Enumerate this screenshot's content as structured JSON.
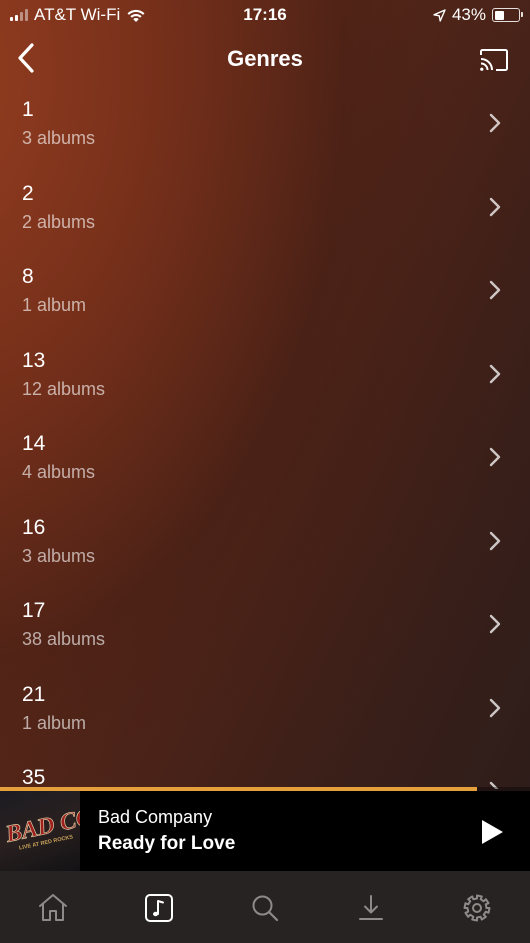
{
  "status_bar": {
    "carrier": "AT&T Wi-Fi",
    "time": "17:16",
    "battery_percent_label": "43%",
    "battery_level": 0.43
  },
  "header": {
    "title": "Genres",
    "back_icon": "chevron-left-icon",
    "cast_icon": "cast-icon"
  },
  "genres": [
    {
      "name": "1",
      "count": "3 albums"
    },
    {
      "name": "2",
      "count": "2 albums"
    },
    {
      "name": "8",
      "count": "1 album"
    },
    {
      "name": "13",
      "count": "12 albums"
    },
    {
      "name": "14",
      "count": "4 albums"
    },
    {
      "name": "16",
      "count": "3 albums"
    },
    {
      "name": "17",
      "count": "38 albums"
    },
    {
      "name": "21",
      "count": "1 album"
    },
    {
      "name": "35",
      "count": ""
    }
  ],
  "mini_player": {
    "artist": "Bad Company",
    "track": "Ready for Love",
    "album_art_text": "BAD CO",
    "album_art_subtext": "LIVE AT RED ROCKS",
    "progress": 0.9,
    "progress_color": "#e5a03b",
    "play_icon": "play-icon"
  },
  "tab_bar": {
    "tabs": [
      {
        "icon": "home-icon",
        "active": false
      },
      {
        "icon": "music-note-icon",
        "active": true
      },
      {
        "icon": "search-icon",
        "active": false
      },
      {
        "icon": "download-icon",
        "active": false
      },
      {
        "icon": "gear-icon",
        "active": false
      }
    ]
  }
}
